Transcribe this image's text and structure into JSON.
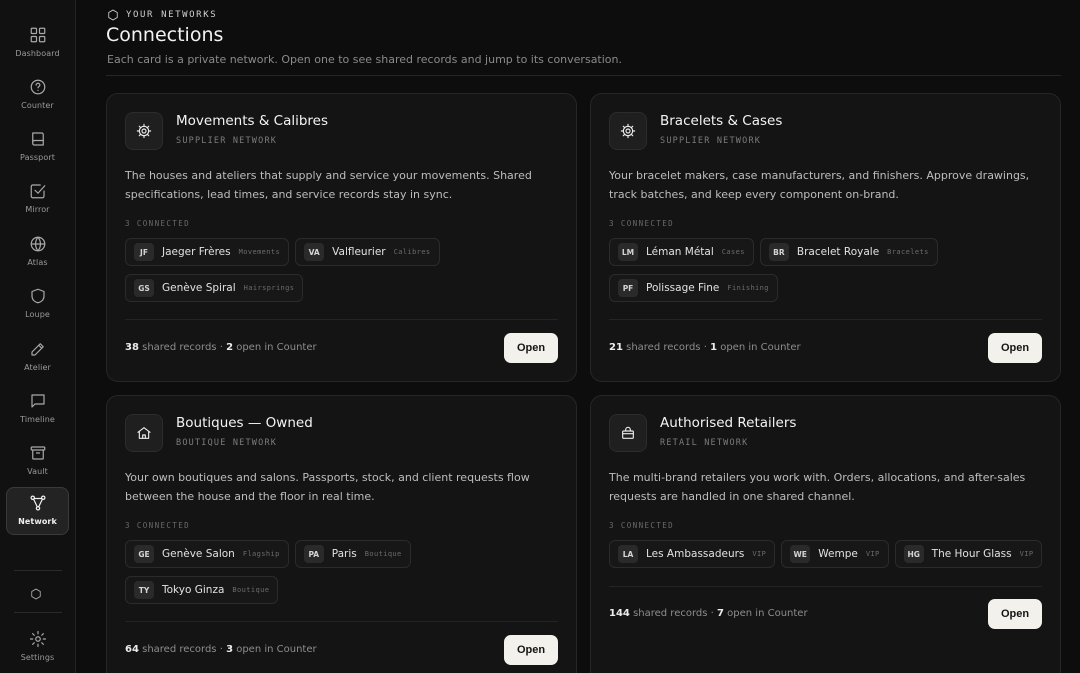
{
  "sidebar": {
    "items": [
      {
        "label": "Dashboard",
        "icon": "grid-icon"
      },
      {
        "label": "Counter",
        "icon": "question-circle-icon"
      },
      {
        "label": "Passport",
        "icon": "book-icon"
      },
      {
        "label": "Mirror",
        "icon": "check-square-icon"
      },
      {
        "label": "Atlas",
        "icon": "globe-icon"
      },
      {
        "label": "Loupe",
        "icon": "shield-icon"
      },
      {
        "label": "Atelier",
        "icon": "pencil-icon"
      },
      {
        "label": "Timeline",
        "icon": "message-square-icon"
      },
      {
        "label": "Vault",
        "icon": "archive-icon"
      },
      {
        "label": "Network",
        "icon": "network-icon",
        "active": true
      }
    ],
    "settings_label": "Settings"
  },
  "header": {
    "eyebrow": "YOUR NETWORKS",
    "title": "Connections",
    "subtitle": "Each card is a private network. Open one to see shared records and jump to its conversation."
  },
  "cards": [
    {
      "title": "Movements & Calibres",
      "type": "SUPPLIER NETWORK",
      "icon": "gear-icon",
      "description": "The houses and ateliers that supply and service your movements. Shared specifications, lead times, and service records stay in sync.",
      "connected": "3 CONNECTED",
      "members": [
        {
          "initials": "JF",
          "name": "Jaeger Frères",
          "role": "Movements"
        },
        {
          "initials": "VA",
          "name": "Valfleurier",
          "role": "Calibres"
        },
        {
          "initials": "GS",
          "name": "Genève Spiral",
          "role": "Hairsprings"
        }
      ],
      "shared_records": "38",
      "shared_label": "shared records ·",
      "open_count": "2",
      "open_label": "open in Counter",
      "button": "Open"
    },
    {
      "title": "Bracelets & Cases",
      "type": "SUPPLIER NETWORK",
      "icon": "gear-icon",
      "description": "Your bracelet makers, case manufacturers, and finishers. Approve drawings, track batches, and keep every component on-brand.",
      "connected": "3 CONNECTED",
      "members": [
        {
          "initials": "LM",
          "name": "Léman Métal",
          "role": "Cases"
        },
        {
          "initials": "BR",
          "name": "Bracelet Royale",
          "role": "Bracelets"
        },
        {
          "initials": "PF",
          "name": "Polissage Fine",
          "role": "Finishing"
        }
      ],
      "shared_records": "21",
      "shared_label": "shared records ·",
      "open_count": "1",
      "open_label": "open in Counter",
      "button": "Open"
    },
    {
      "title": "Boutiques — Owned",
      "type": "BOUTIQUE NETWORK",
      "icon": "home-icon",
      "description": "Your own boutiques and salons. Passports, stock, and client requests flow between the house and the floor in real time.",
      "connected": "3 CONNECTED",
      "members": [
        {
          "initials": "GE",
          "name": "Genève Salon",
          "role": "Flagship"
        },
        {
          "initials": "PA",
          "name": "Paris",
          "role": "Boutique"
        },
        {
          "initials": "TY",
          "name": "Tokyo Ginza",
          "role": "Boutique"
        }
      ],
      "shared_records": "64",
      "shared_label": "shared records ·",
      "open_count": "3",
      "open_label": "open in Counter",
      "button": "Open"
    },
    {
      "title": "Authorised Retailers",
      "type": "RETAIL NETWORK",
      "icon": "shopping-bag-icon",
      "description": "The multi-brand retailers you work with. Orders, allocations, and after-sales requests are handled in one shared channel.",
      "connected": "3 CONNECTED",
      "members": [
        {
          "initials": "LA",
          "name": "Les Ambassadeurs",
          "role": "VIP"
        },
        {
          "initials": "WE",
          "name": "Wempe",
          "role": "VIP"
        },
        {
          "initials": "HG",
          "name": "The Hour Glass",
          "role": "VIP"
        }
      ],
      "shared_records": "144",
      "shared_label": "shared records ·",
      "open_count": "7",
      "open_label": "open in Counter",
      "button": "Open"
    }
  ]
}
